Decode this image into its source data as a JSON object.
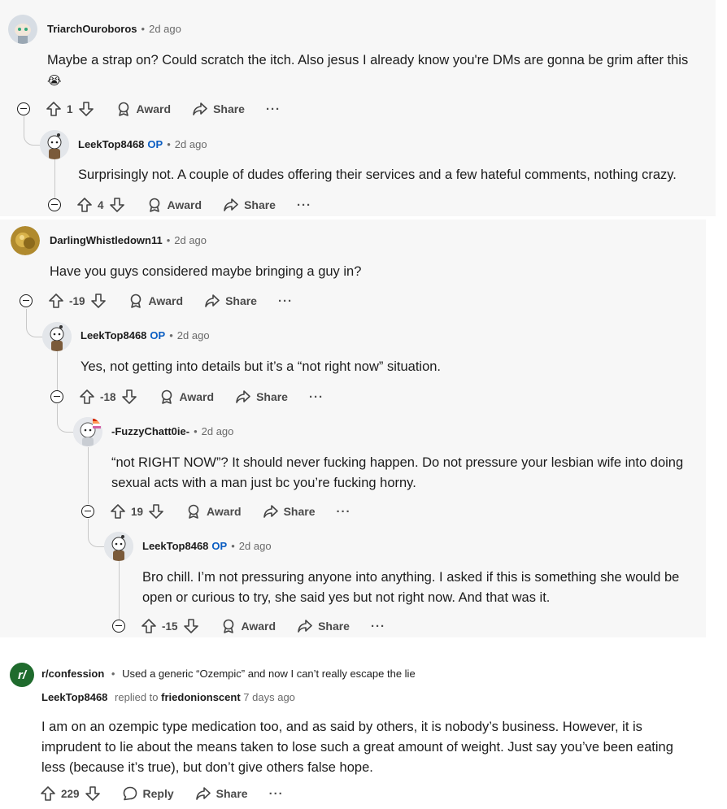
{
  "thread": {
    "comments": [
      {
        "author": "TriarchOuroboros",
        "time": "2d ago",
        "text": "Maybe a strap on? Could scratch the itch. Also jesus I already know you're DMs are gonna be grim after this",
        "emoji": "😭",
        "votes": "1"
      },
      {
        "author": "LeekTop8468",
        "op": "OP",
        "time": "2d ago",
        "text": "Surprisingly not. A couple of dudes offering their services and a few hateful comments, nothing crazy.",
        "votes": "4"
      },
      {
        "author": "DarlingWhistledown11",
        "time": "2d ago",
        "text": "Have you guys considered maybe bringing a guy in?",
        "votes": "-19"
      },
      {
        "author": "LeekTop8468",
        "op": "OP",
        "time": "2d ago",
        "text": "Yes, not getting into details but it’s a “not right now” situation.",
        "votes": "-18"
      },
      {
        "author": "-FuzzyChatt0ie-",
        "time": "2d ago",
        "text": "“not RIGHT NOW”? It should never fucking happen. Do not pressure your lesbian wife into doing sexual acts with a man just bc you’re fucking horny.",
        "votes": "19"
      },
      {
        "author": "LeekTop8468",
        "op": "OP",
        "time": "2d ago",
        "text": "Bro chill. I’m not pressuring anyone into anything. I asked if this is something she would be open or curious to try, she said yes but not right now. And that was it.",
        "votes": "-15"
      }
    ],
    "labels": {
      "award": "Award",
      "share": "Share",
      "more": "···"
    }
  },
  "search_result": {
    "subreddit_icon": "r/",
    "subreddit": "r/confession",
    "separator": "•",
    "post_title": "Used a generic “Ozempic” and now I can’t really escape the lie",
    "author": "LeekTop8468",
    "replied_to_label": "replied to",
    "replied_to": "friedonionscent",
    "time": "7 days ago",
    "text": "I am on an ozempic type medication too, and as said by others, it is nobody’s business. However, it is imprudent to lie about the means taken to lose such a great amount of weight. Just say you’ve been eating less (because it’s true), but don’t give others false hope.",
    "votes": "229",
    "reply_label": "Reply",
    "share_label": "Share",
    "more": "···"
  },
  "colors": {
    "panel_bg": "#f7f7f7",
    "op_blue": "#0a5dc2",
    "subreddit_green": "#1f6b2d"
  }
}
